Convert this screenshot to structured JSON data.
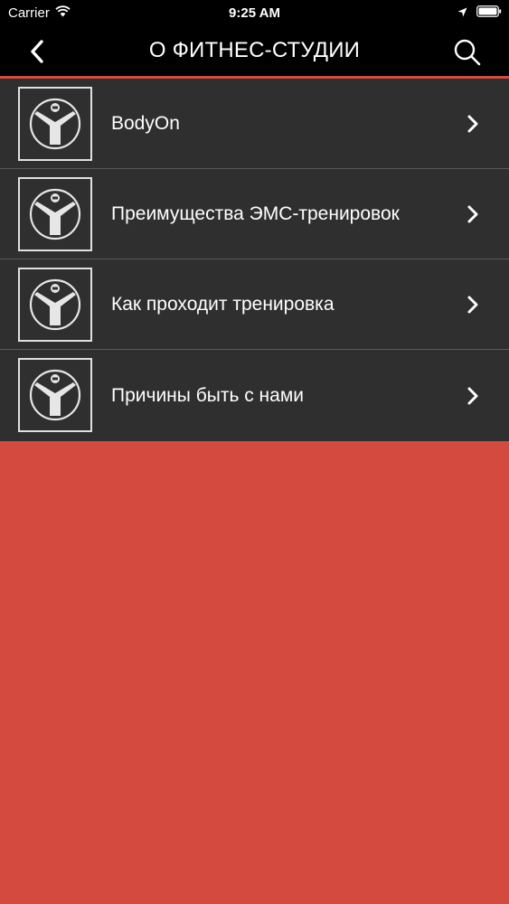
{
  "status_bar": {
    "carrier": "Carrier",
    "time": "9:25 AM"
  },
  "nav": {
    "title": "О ФИТНЕС-СТУДИИ",
    "back_icon": "chevron-left-icon",
    "search_icon": "search-icon"
  },
  "list": {
    "items": [
      {
        "label": "BodyOn",
        "icon": "bodyon-logo-icon"
      },
      {
        "label": "Преимущества ЭМС-тренировок",
        "icon": "bodyon-logo-icon"
      },
      {
        "label": "Как проходит тренировка",
        "icon": "bodyon-logo-icon"
      },
      {
        "label": "Причины быть с нами",
        "icon": "bodyon-logo-icon"
      }
    ]
  },
  "colors": {
    "background": "#d44a3e",
    "header": "#000000",
    "list_bg": "#2f2f2f",
    "divider": "#5a5a5a",
    "text": "#ffffff"
  }
}
